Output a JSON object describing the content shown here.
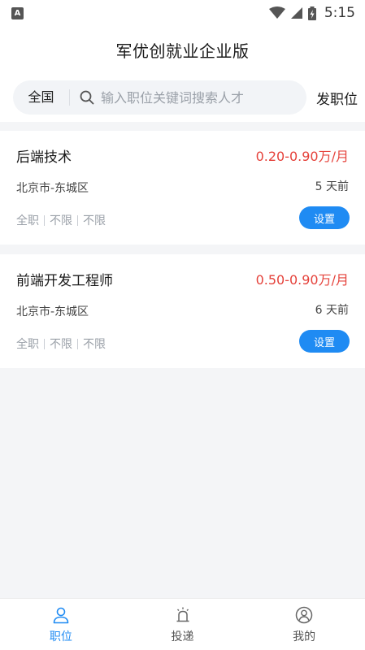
{
  "status_bar": {
    "badge": "A",
    "time": "5:15"
  },
  "header": {
    "title": "军优创就业企业版"
  },
  "search": {
    "region": "全国",
    "placeholder": "输入职位关键词搜索人才",
    "post_label": "发职位"
  },
  "jobs": [
    {
      "title": "后端技术",
      "salary": "0.20-0.90万/月",
      "location": "北京市-东城区",
      "posted": "5 天前",
      "tags": [
        "全职",
        "不限",
        "不限"
      ],
      "action": "设置"
    },
    {
      "title": "前端开发工程师",
      "salary": "0.50-0.90万/月",
      "location": "北京市-东城区",
      "posted": "6 天前",
      "tags": [
        "全职",
        "不限",
        "不限"
      ],
      "action": "设置"
    }
  ],
  "tabbar": {
    "items": [
      {
        "label": "职位",
        "icon": "person-icon",
        "active": true
      },
      {
        "label": "投递",
        "icon": "alarm-light-icon",
        "active": false
      },
      {
        "label": "我的",
        "icon": "profile-circle-icon",
        "active": false
      }
    ]
  },
  "colors": {
    "accent": "#1f8bf3",
    "salary": "#e5423b"
  }
}
